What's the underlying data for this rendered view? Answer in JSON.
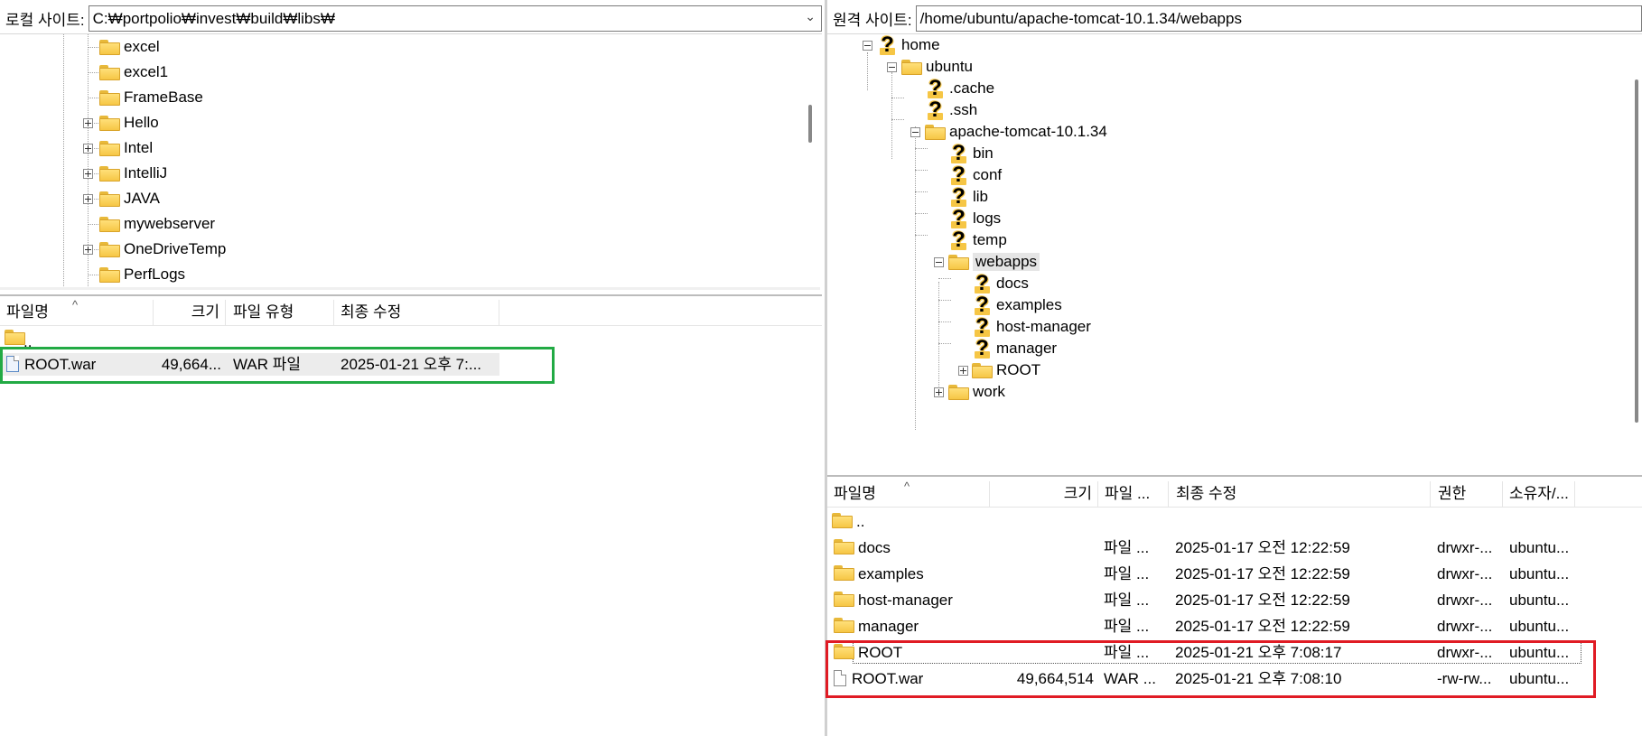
{
  "local": {
    "label": "로컬 사이트:",
    "path": "C:₩portpolio₩invest₩build₩libs₩",
    "tree": [
      {
        "name": "excel",
        "expand": "none"
      },
      {
        "name": "excel1",
        "expand": "none"
      },
      {
        "name": "FrameBase",
        "expand": "none"
      },
      {
        "name": "Hello",
        "expand": "plus"
      },
      {
        "name": "Intel",
        "expand": "plus"
      },
      {
        "name": "IntelliJ",
        "expand": "plus"
      },
      {
        "name": "JAVA",
        "expand": "plus"
      },
      {
        "name": "mywebserver",
        "expand": "none"
      },
      {
        "name": "OneDriveTemp",
        "expand": "plus"
      },
      {
        "name": "PerfLogs",
        "expand": "none"
      }
    ],
    "columns": {
      "name": "파일명",
      "size": "크기",
      "type": "파일 유형",
      "modified": "최종 수정"
    },
    "parent": "..",
    "files": [
      {
        "name": "ROOT.war",
        "size": "49,664...",
        "type": "WAR 파일",
        "modified": "2025-01-21 오후 7:..."
      }
    ]
  },
  "remote": {
    "label": "원격 사이트:",
    "path": "/home/ubuntu/apache-tomcat-10.1.34/webapps",
    "tree": {
      "home": "home",
      "ubuntu": "ubuntu",
      "cache": ".cache",
      "ssh": ".ssh",
      "tomcat": "apache-tomcat-10.1.34",
      "bin": "bin",
      "conf": "conf",
      "lib": "lib",
      "logs": "logs",
      "temp": "temp",
      "webapps": "webapps",
      "docs": "docs",
      "examples": "examples",
      "hostmanager": "host-manager",
      "manager": "manager",
      "root": "ROOT",
      "work": "work"
    },
    "columns": {
      "name": "파일명",
      "size": "크기",
      "type": "파일 ...",
      "modified": "최종 수정",
      "perm": "권한",
      "owner": "소유자/..."
    },
    "parent": "..",
    "files": [
      {
        "name": "docs",
        "size": "",
        "type": "파일 ...",
        "modified": "2025-01-17 오전 12:22:59",
        "perm": "drwxr-...",
        "owner": "ubuntu..."
      },
      {
        "name": "examples",
        "size": "",
        "type": "파일 ...",
        "modified": "2025-01-17 오전 12:22:59",
        "perm": "drwxr-...",
        "owner": "ubuntu..."
      },
      {
        "name": "host-manager",
        "size": "",
        "type": "파일 ...",
        "modified": "2025-01-17 오전 12:22:59",
        "perm": "drwxr-...",
        "owner": "ubuntu..."
      },
      {
        "name": "manager",
        "size": "",
        "type": "파일 ...",
        "modified": "2025-01-17 오전 12:22:59",
        "perm": "drwxr-...",
        "owner": "ubuntu..."
      },
      {
        "name": "ROOT",
        "size": "",
        "type": "파일 ...",
        "modified": "2025-01-21 오후 7:08:17",
        "perm": "drwxr-...",
        "owner": "ubuntu..."
      },
      {
        "name": "ROOT.war",
        "size": "49,664,514",
        "type": "WAR ...",
        "modified": "2025-01-21 오후 7:08:10",
        "perm": "-rw-rw...",
        "owner": "ubuntu..."
      }
    ]
  },
  "highlights": {
    "green": "#22aa44",
    "red": "#e01b24"
  }
}
